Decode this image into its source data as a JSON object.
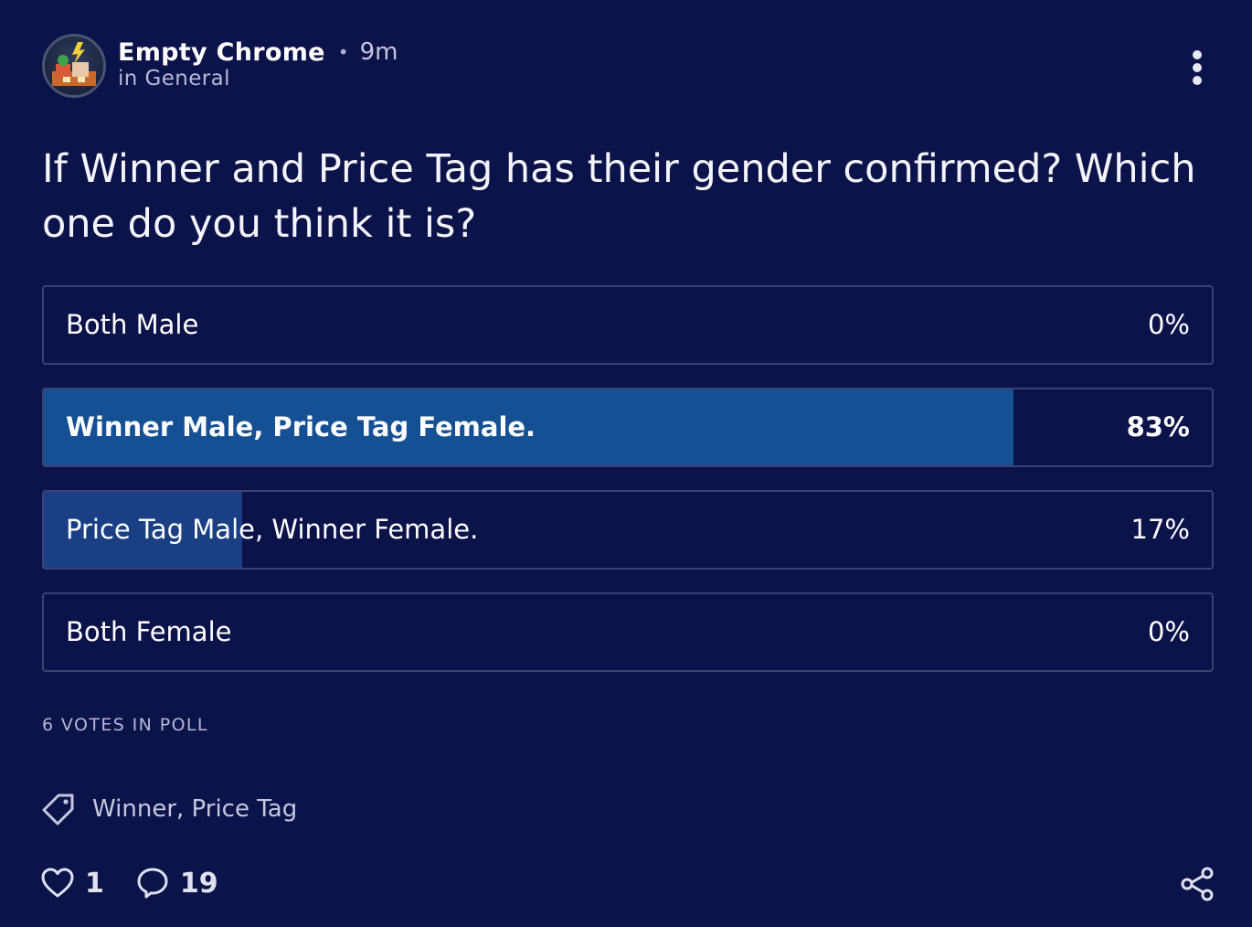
{
  "post": {
    "author": "Empty Chrome",
    "separator": "•",
    "time": "9m",
    "category": "in General",
    "title": "If Winner and Price Tag has their gender confirmed? Which one do you think it is?"
  },
  "poll": {
    "options": [
      {
        "label": "Both Male",
        "percent_label": "0%",
        "percent": 0
      },
      {
        "label": "Winner Male, Price Tag Female.",
        "percent_label": "83%",
        "percent": 83
      },
      {
        "label": "Price Tag Male, Winner Female.",
        "percent_label": "17%",
        "percent": 17
      },
      {
        "label": "Both Female",
        "percent_label": "0%",
        "percent": 0
      }
    ],
    "votes_label": "6 votes in poll"
  },
  "tags": {
    "icon": "tag-icon",
    "text": "Winner, Price Tag"
  },
  "actions": {
    "like_icon": "heart-icon",
    "like_count": "1",
    "comment_icon": "comment-bubble-icon",
    "comment_count": "19",
    "share_icon": "share-icon",
    "more_icon": "more-vertical-icon"
  },
  "colors": {
    "background": "#0c124a",
    "option_border": "#3a4276",
    "leader_fill": "#155094",
    "other_fill": "#1a3f85",
    "text_primary": "#ffffff",
    "text_secondary": "#b4bad2"
  }
}
